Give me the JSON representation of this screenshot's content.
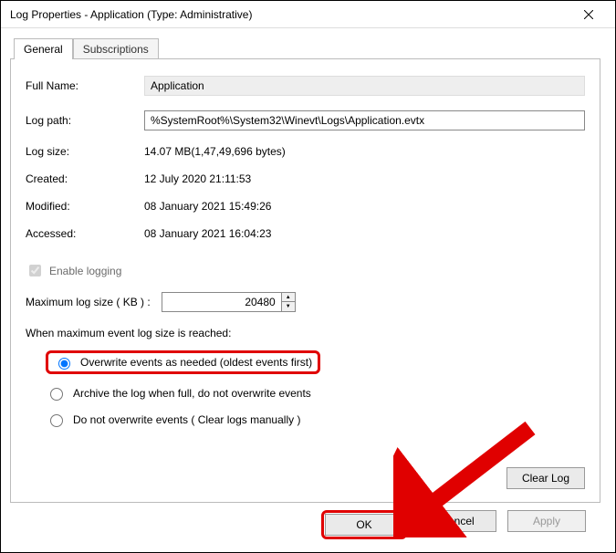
{
  "window": {
    "title": "Log Properties - Application (Type: Administrative)"
  },
  "tabs": {
    "general": "General",
    "subscriptions": "Subscriptions"
  },
  "props": {
    "full_name_label": "Full Name:",
    "full_name_value": "Application",
    "log_path_label": "Log path:",
    "log_path_value": "%SystemRoot%\\System32\\Winevt\\Logs\\Application.evtx",
    "log_size_label": "Log size:",
    "log_size_value": "14.07 MB(1,47,49,696 bytes)",
    "created_label": "Created:",
    "created_value": "12 July 2020 21:11:53",
    "modified_label": "Modified:",
    "modified_value": "08 January 2021 15:49:26",
    "accessed_label": "Accessed:",
    "accessed_value": "08 January 2021 16:04:23"
  },
  "logging": {
    "enable_label": "Enable logging",
    "enable_checked": true,
    "max_label": "Maximum log size ( KB ) :",
    "max_value": "20480",
    "when_label": "When maximum event log size is reached:",
    "opt_overwrite": "Overwrite events as needed (oldest events first)",
    "opt_archive": "Archive the log when full, do not overwrite events",
    "opt_donot": "Do not overwrite events ( Clear logs manually )",
    "selected": "overwrite"
  },
  "buttons": {
    "clear_log": "Clear Log",
    "ok": "OK",
    "cancel": "Cancel",
    "apply": "Apply"
  }
}
